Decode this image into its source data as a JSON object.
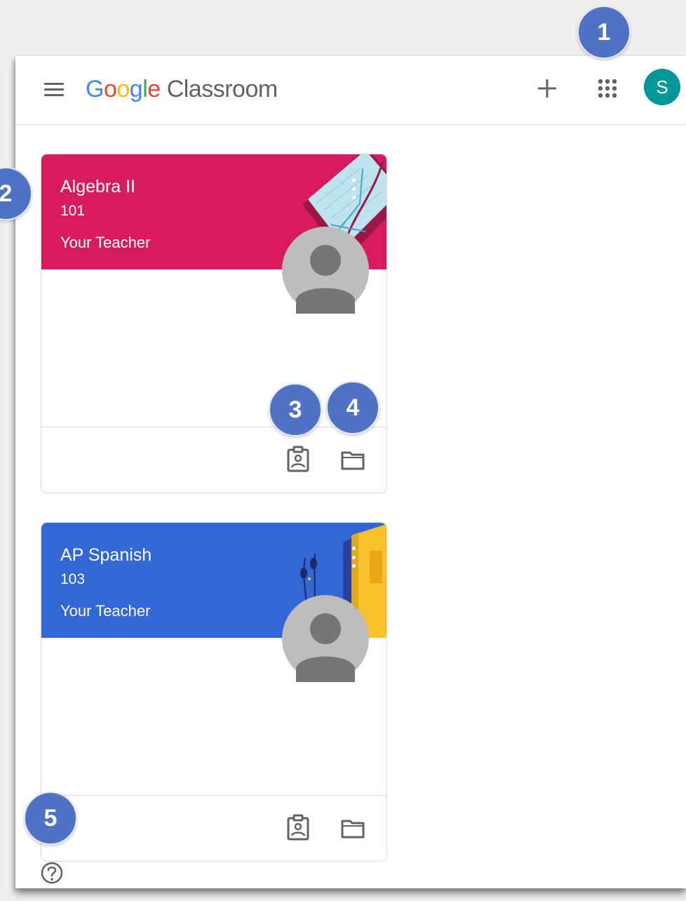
{
  "header": {
    "logo_letters": [
      "G",
      "o",
      "o",
      "g",
      "l",
      "e"
    ],
    "product_name": "Classroom",
    "avatar_initial": "S"
  },
  "icons": {
    "menu": "hamburger-menu-icon",
    "create": "plus-icon",
    "apps": "apps-grid-icon",
    "classwork": "assignment-ind-icon",
    "folder": "folder-icon",
    "help": "help-circle-icon",
    "more": "more-vert-icon"
  },
  "colors": {
    "algebra_banner": "#d81b60",
    "spanish_banner": "#3367d6",
    "avatar": "#00979a",
    "badge": "#4f72c4"
  },
  "classes": [
    {
      "name": "Algebra II",
      "section": "101",
      "teacher": "Your Teacher"
    },
    {
      "name": "AP Spanish",
      "section": "103",
      "teacher": "Your Teacher"
    }
  ],
  "callouts": [
    "1",
    "2",
    "3",
    "4",
    "5"
  ]
}
